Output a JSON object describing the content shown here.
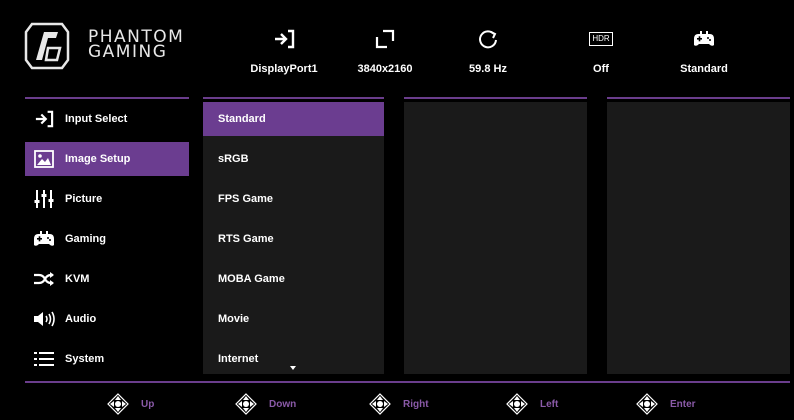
{
  "brand": {
    "line1": "PHANTOM",
    "line2": "GAMING"
  },
  "status_bar": [
    {
      "icon": "input-arrow-icon",
      "label": "DisplayPort1"
    },
    {
      "icon": "resolution-icon",
      "label": "3840x2160"
    },
    {
      "icon": "refresh-rate-icon",
      "label": "59.8 Hz"
    },
    {
      "icon": "hdr-icon",
      "badge": "HDR",
      "label": "Off"
    },
    {
      "icon": "gamepad-icon",
      "label": "Standard"
    }
  ],
  "sidebar": {
    "items": [
      {
        "label": "Input Select",
        "icon": "input-arrow-icon",
        "active": false
      },
      {
        "label": "Image Setup",
        "icon": "image-icon",
        "active": true
      },
      {
        "label": "Picture",
        "icon": "sliders-icon",
        "active": false
      },
      {
        "label": "Gaming",
        "icon": "gamepad-icon",
        "active": false
      },
      {
        "label": "KVM",
        "icon": "shuffle-icon",
        "active": false
      },
      {
        "label": "Audio",
        "icon": "speaker-icon",
        "active": false
      },
      {
        "label": "System",
        "icon": "list-icon",
        "active": false
      }
    ]
  },
  "submenu": {
    "items": [
      "Standard",
      "sRGB",
      "FPS Game",
      "RTS Game",
      "MOBA Game",
      "Movie",
      "Internet"
    ],
    "selected": "Standard"
  },
  "footer": [
    {
      "label": "Up",
      "icon": "dpad-up-icon"
    },
    {
      "label": "Down",
      "icon": "dpad-down-icon"
    },
    {
      "label": "Right",
      "icon": "dpad-right-icon"
    },
    {
      "label": "Left",
      "icon": "dpad-left-icon"
    },
    {
      "label": "Enter",
      "icon": "dpad-enter-icon"
    }
  ],
  "colors": {
    "accent": "#6b3d90",
    "panel": "#1a1a1a",
    "footer_text": "#8a5aa8"
  }
}
